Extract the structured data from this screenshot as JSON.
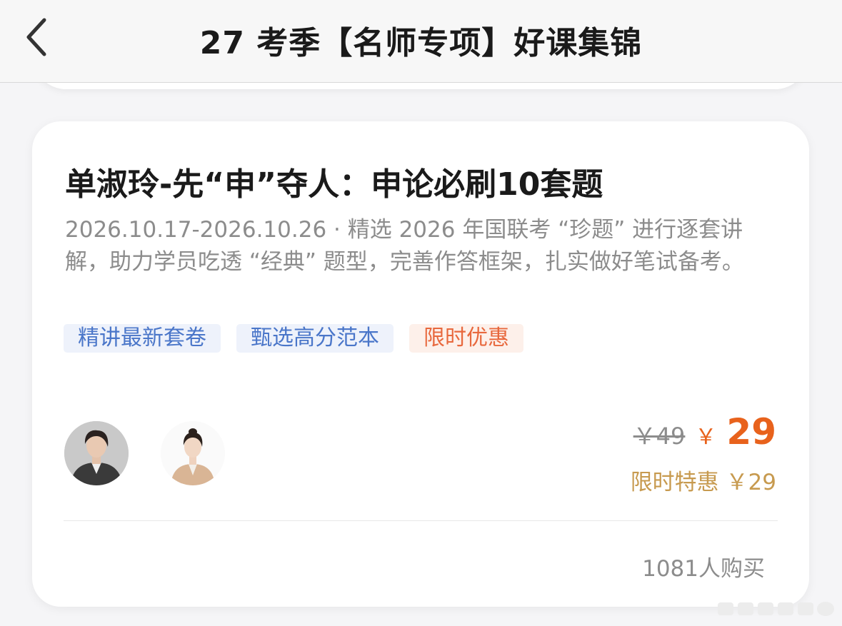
{
  "header": {
    "title": "27 考季【名师专项】好课集锦",
    "back_icon": "chevron-left-icon"
  },
  "course": {
    "title": "单淑玲-先“申”夺人：申论必刷10套题",
    "description": "2026.10.17-2026.10.26 · 精选 2026 年国联考 “珍题” 进行逐套讲解，助力学员吃透 “经典” 题型，完善作答框架，扎实做好笔试备考。",
    "tags": [
      {
        "label": "精讲最新套卷",
        "color": "#4a76c9"
      },
      {
        "label": "甄选高分范本",
        "color": "#4a76c9"
      },
      {
        "label": "限时优惠",
        "color": "#e8683d"
      }
    ],
    "teachers": [
      "teacher-avatar",
      "teacher-avatar"
    ],
    "original_price": "￥49",
    "currency_symbol": "￥",
    "current_price": "29",
    "promo_text": "限时特惠 ￥29",
    "buyers": "1081人购买"
  },
  "colors": {
    "accent": "#e8621c",
    "promo": "#c79a4f",
    "tag_blue": "#4a76c9"
  }
}
